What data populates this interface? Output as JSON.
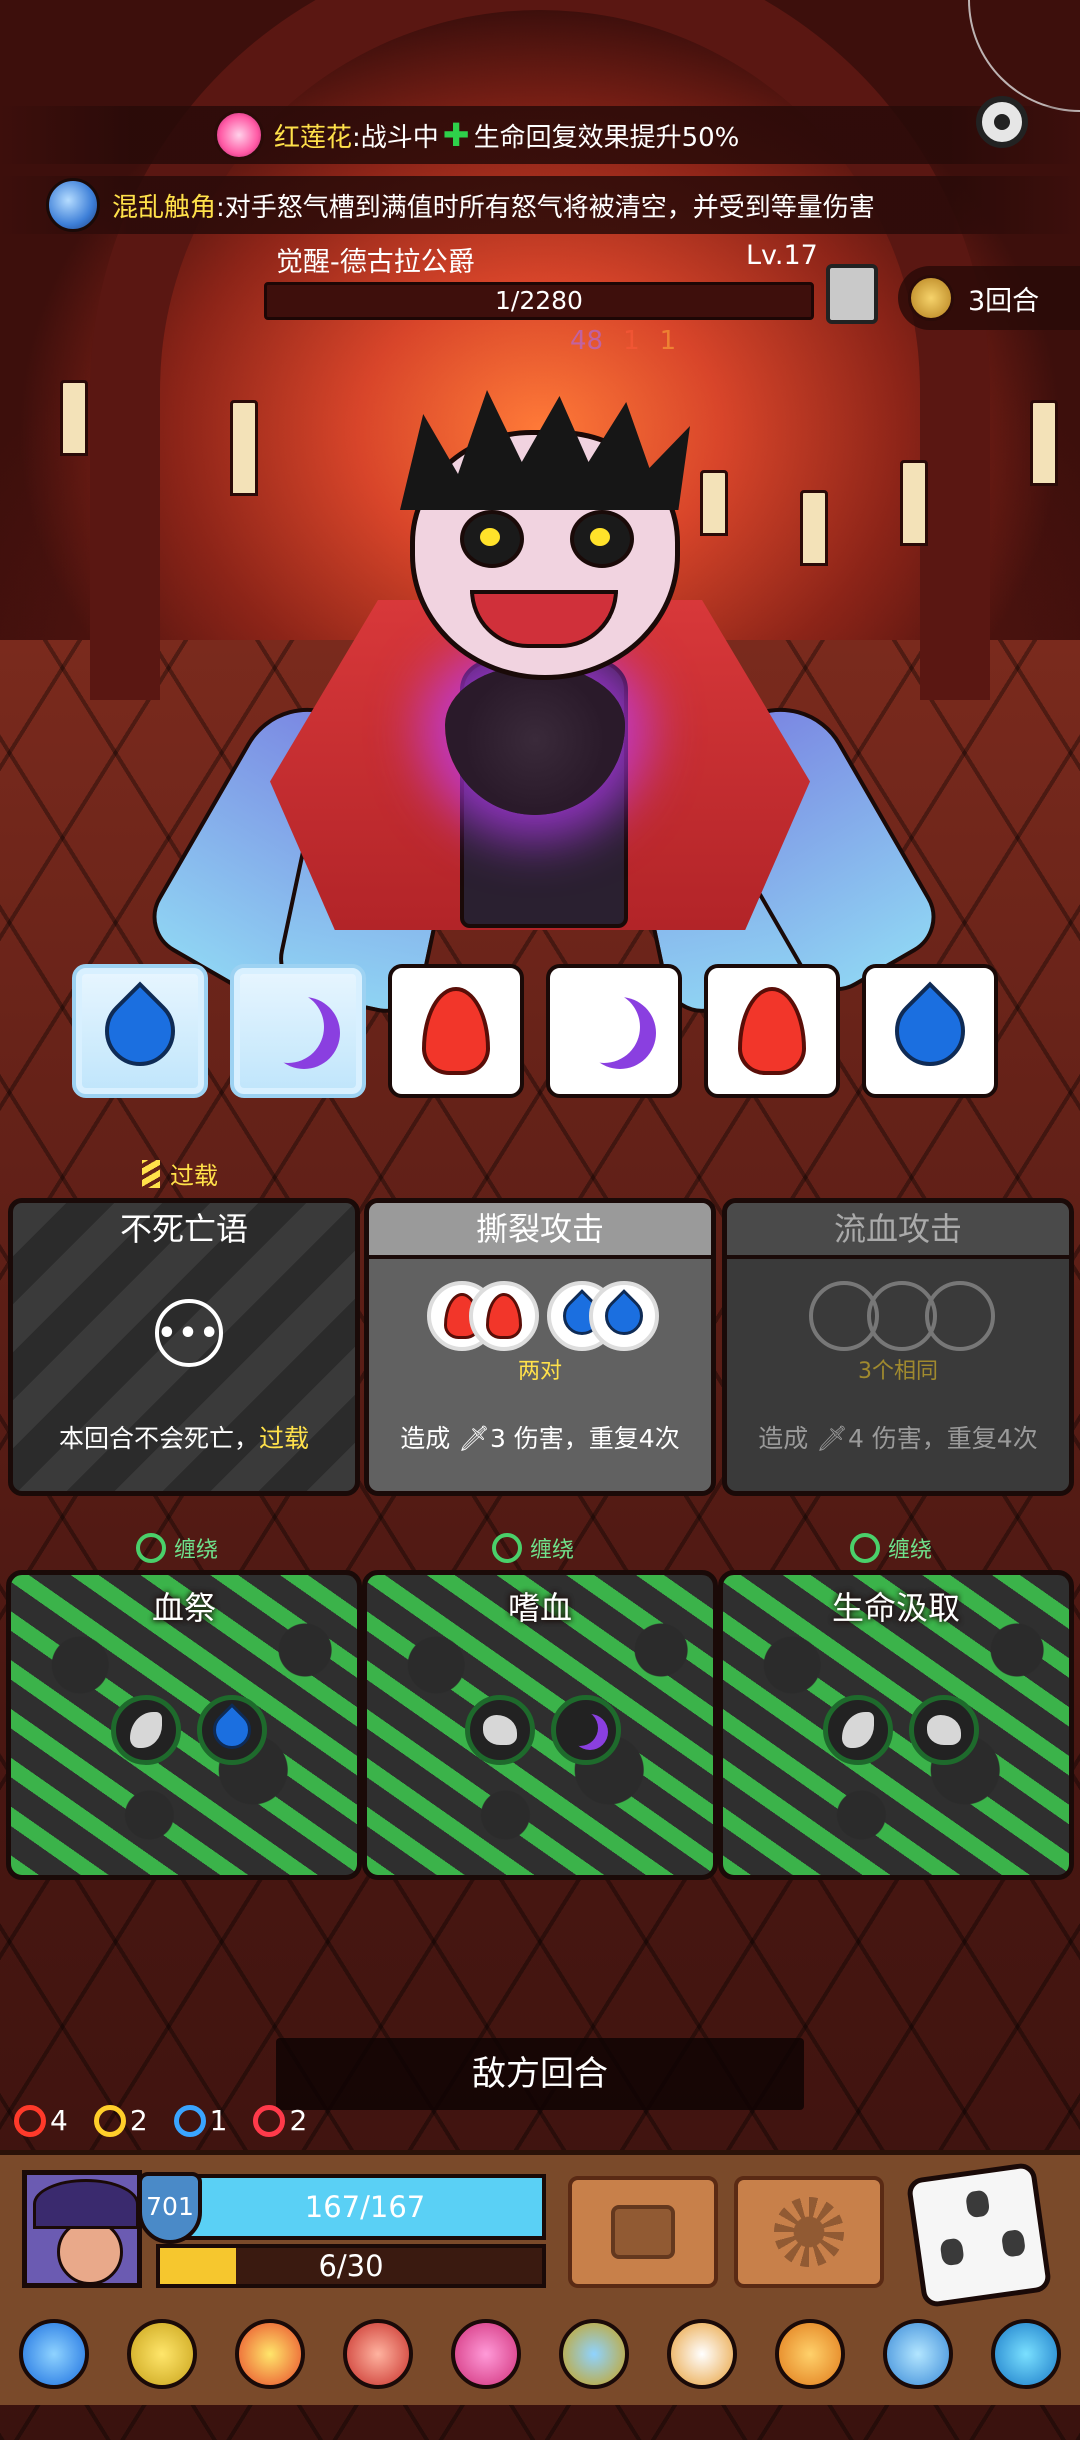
{
  "banners": {
    "lotus_name": "红莲花",
    "lotus_text_a": ":战斗中 ",
    "lotus_plus": "✚",
    "lotus_text_b": "生命回复效果提升50%",
    "tentacle_name": "混乱触角",
    "tentacle_text": ":对手怒气槽到满值时所有怒气将被清空，并受到等量伤害"
  },
  "boss": {
    "name": "觉醒-德古拉公爵",
    "level": "Lv.17",
    "hp_text": "1/2280",
    "turns": "3回合",
    "status": [
      "48",
      "1",
      "1"
    ]
  },
  "dice": [
    {
      "icon": "water-drop-icon",
      "frozen": true
    },
    {
      "icon": "moon-icon",
      "frozen": true
    },
    {
      "icon": "flame-icon",
      "frozen": false
    },
    {
      "icon": "moon-icon",
      "frozen": false
    },
    {
      "icon": "flame-icon",
      "frozen": false
    },
    {
      "icon": "water-drop-icon",
      "frozen": false
    }
  ],
  "skills": {
    "overload_tag": "过载",
    "card1": {
      "title": "不死亡语",
      "desc": "本回合不会死亡，",
      "desc_hl": "过载"
    },
    "card2": {
      "title": "撕裂攻击",
      "req": "两对",
      "desc": "造成 🗡3 伤害，重复4次"
    },
    "card3": {
      "title": "流血攻击",
      "req": "3个相同",
      "desc": "造成 🗡4 伤害，重复4次"
    }
  },
  "vines": {
    "tag": "缠绕",
    "cards": [
      "血祭",
      "嗜血",
      "生命汲取"
    ]
  },
  "enemy_turn": "敌方回合",
  "player": {
    "stats": [
      "4",
      "2",
      "1",
      "2"
    ],
    "shield": "701",
    "hp_text": "167/167",
    "energy_text": "6/30",
    "energy_fraction": 0.2
  },
  "colors": {
    "accent_yellow": "#ffe14a",
    "vine_green": "#3bb34a",
    "hp_blue": "#5ad0f5",
    "energy_yellow": "#f6c72e"
  }
}
